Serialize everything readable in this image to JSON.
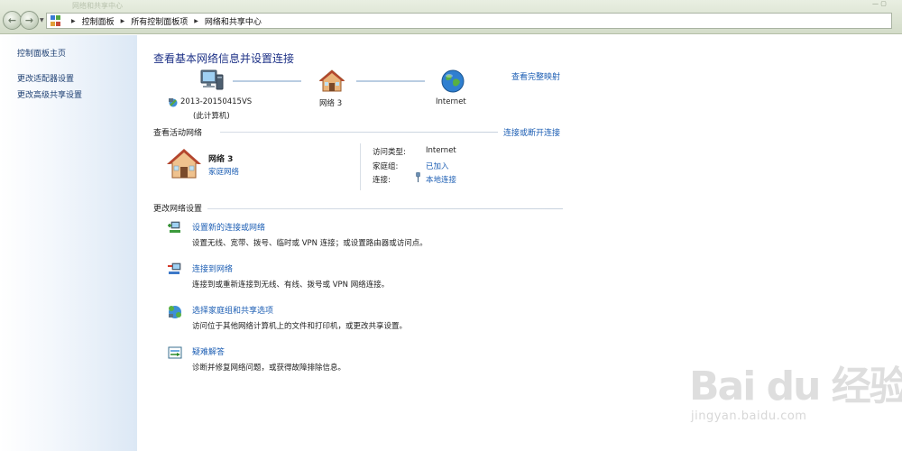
{
  "window": {
    "title": "网络和共享中心",
    "controls": "— ▢"
  },
  "addressbar": {
    "breadcrumbs": [
      "控制面板",
      "所有控制面板项",
      "网络和共享中心"
    ]
  },
  "sidebar": {
    "items": [
      {
        "label": "控制面板主页"
      },
      {
        "label": "更改适配器设置"
      },
      {
        "label": "更改高级共享设置"
      }
    ]
  },
  "main": {
    "title": "查看基本网络信息并设置连接",
    "view_full_map": "查看完整映射",
    "map": {
      "computer_name": "2013-20150415VS",
      "computer_sub": "(此计算机)",
      "network": "网络  3",
      "internet": "Internet"
    },
    "active": {
      "header": "查看活动网络",
      "connect_link": "连接或断开连接",
      "network_name": "网络  3",
      "network_type": "家庭网络",
      "access_type_label": "访问类型:",
      "access_type_value": "Internet",
      "homegroup_label": "家庭组:",
      "homegroup_value": "已加入",
      "connection_label": "连接:",
      "connection_value": "本地连接"
    },
    "settings": {
      "header": "更改网络设置",
      "tasks": [
        {
          "title": "设置新的连接或网络",
          "desc": "设置无线、宽带、拨号、临时或 VPN 连接；或设置路由器或访问点。"
        },
        {
          "title": "连接到网络",
          "desc": "连接到或重新连接到无线、有线、拨号或 VPN 网络连接。"
        },
        {
          "title": "选择家庭组和共享选项",
          "desc": "访问位于其他网络计算机上的文件和打印机，或更改共享设置。"
        },
        {
          "title": "疑难解答",
          "desc": "诊断并修复网络问题，或获得故障排除信息。"
        }
      ]
    }
  },
  "watermark": {
    "brand": "Bai du 经验",
    "url": "jingyan.baidu.com"
  },
  "colors": {
    "link": "#1e5fb4",
    "title": "#1e3287",
    "sidebar_link": "#1d3f72"
  }
}
